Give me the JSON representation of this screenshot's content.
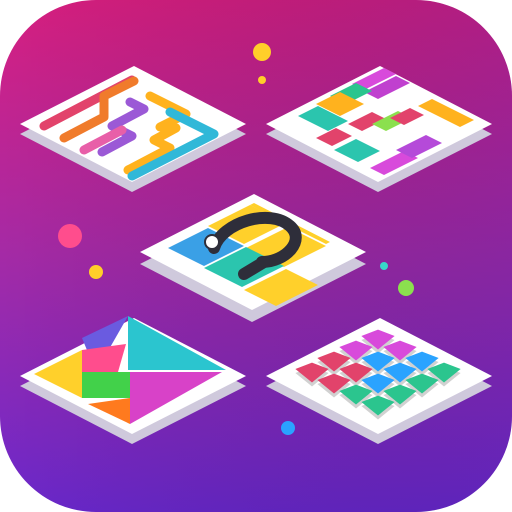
{
  "app_icon": {
    "background_gradient": [
      "#d4227e",
      "#a72aa8",
      "#6e27c9"
    ],
    "tile_top_color": "#ffffff",
    "tile_side_color": "#c9c4d6",
    "tiles": [
      {
        "name": "flow-lines",
        "icon": "pipe-lines-icon"
      },
      {
        "name": "block-puzzle",
        "icon": "sliding-blocks-icon"
      },
      {
        "name": "unblock-ball",
        "icon": "ball-path-icon"
      },
      {
        "name": "tangram",
        "icon": "tangram-icon"
      },
      {
        "name": "color-grid",
        "icon": "grid-blocks-icon"
      }
    ],
    "dot_colors": [
      "#ffcf2a",
      "#ff4d8d",
      "#37d8c9",
      "#8be04e",
      "#2aa3ff"
    ]
  }
}
